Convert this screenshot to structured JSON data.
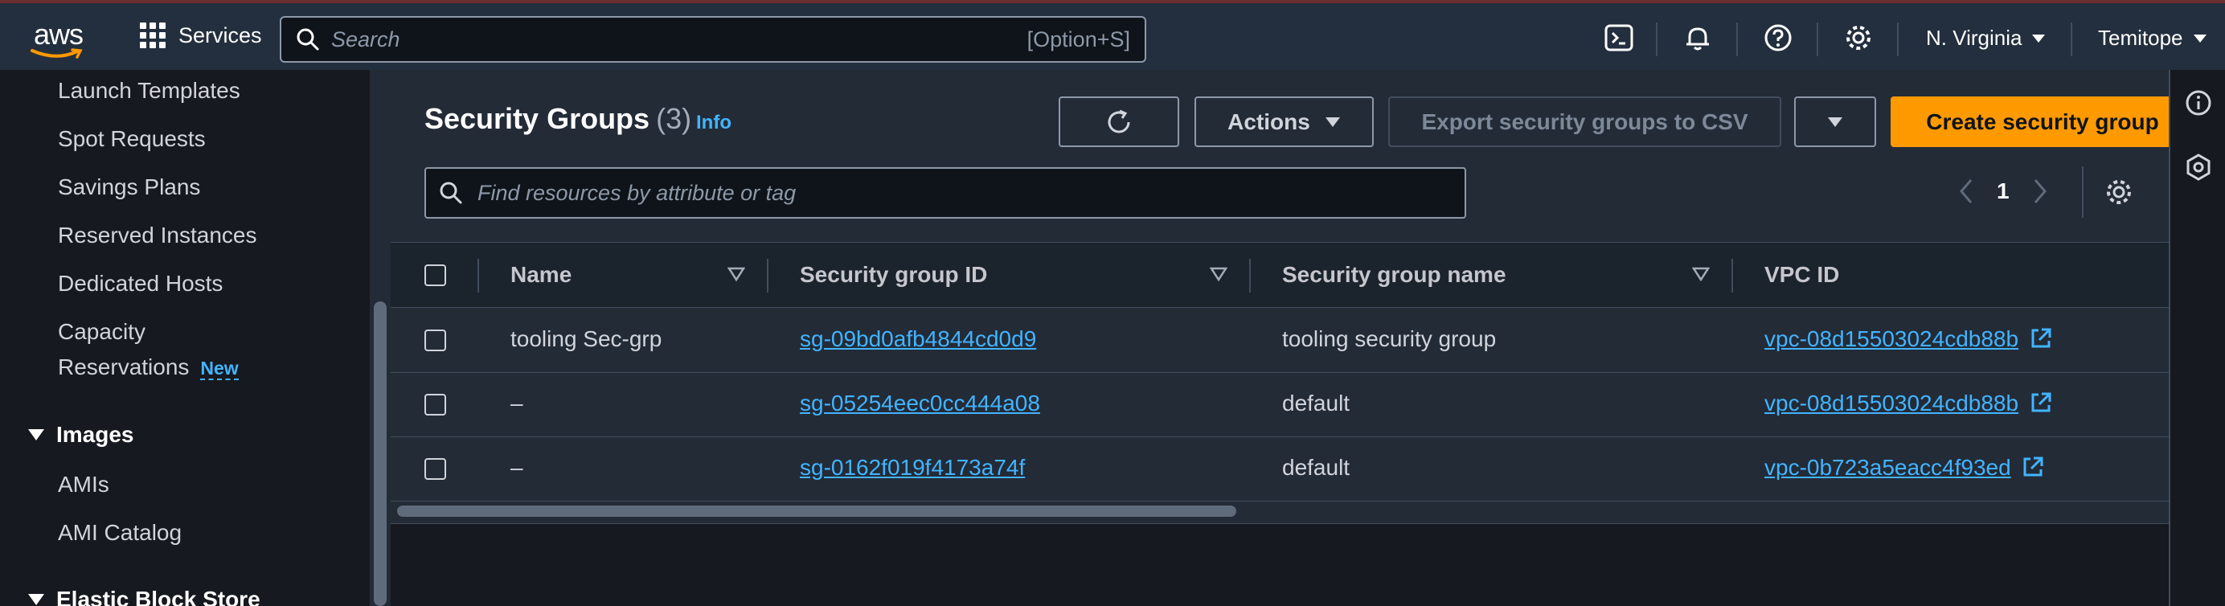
{
  "topnav": {
    "logo_text": "aws",
    "services_label": "Services",
    "search_placeholder": "Search",
    "search_shortcut": "[Option+S]",
    "region": "N. Virginia",
    "user": "Temitope"
  },
  "sidebar": {
    "items": [
      {
        "label": "Launch Templates"
      },
      {
        "label": "Spot Requests"
      },
      {
        "label": "Savings Plans"
      },
      {
        "label": "Reserved Instances"
      },
      {
        "label": "Dedicated Hosts"
      },
      {
        "label": "Capacity"
      },
      {
        "label": "Reservations"
      }
    ],
    "new_badge": "New",
    "sections": {
      "images": "Images",
      "ebs": "Elastic Block Store"
    },
    "images_items": [
      {
        "label": "AMIs"
      },
      {
        "label": "AMI Catalog"
      }
    ]
  },
  "main": {
    "title": "Security Groups",
    "count": "(3)",
    "info": "Info",
    "actions_label": "Actions",
    "export_label": "Export security groups to CSV",
    "create_label": "Create security group",
    "filter_placeholder": "Find resources by attribute or tag",
    "page_number": "1",
    "columns": [
      "Name",
      "Security group ID",
      "Security group name",
      "VPC ID"
    ],
    "rows": [
      {
        "name": "tooling Sec-grp",
        "sg_id": "sg-09bd0afb4844cd0d9",
        "sg_name": "tooling security group",
        "vpc_id": "vpc-08d15503024cdb88b"
      },
      {
        "name": "–",
        "sg_id": "sg-05254eec0cc444a08",
        "sg_name": "default",
        "vpc_id": "vpc-08d15503024cdb88b"
      },
      {
        "name": "–",
        "sg_id": "sg-0162f019f4173a74f",
        "sg_name": "default",
        "vpc_id": "vpc-0b723a5eacc4f93ed"
      }
    ]
  },
  "colors": {
    "accent_orange": "#ff9900",
    "link_blue": "#42b4ff",
    "nav_bg": "#232f3e"
  }
}
